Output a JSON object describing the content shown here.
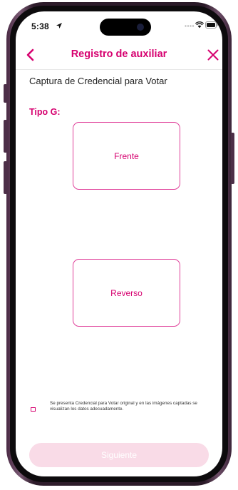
{
  "status_bar": {
    "time": "5:38",
    "icons": [
      "location-arrow-icon",
      "signal-icon",
      "wifi-icon",
      "battery-icon"
    ]
  },
  "header": {
    "title": "Registro de auxiliar",
    "back_icon": "chevron-left-icon",
    "close_icon": "close-icon"
  },
  "main": {
    "section_title": "Captura de Credencial para Votar",
    "type_label": "Tipo G:",
    "front_label": "Frente",
    "back_label": "Reverso"
  },
  "consent": {
    "checked": false,
    "text": "Se presenta Credencial para Votar original y en las imágenes captadas se visualizan los datos adecuadamente."
  },
  "footer": {
    "next_label": "Siguiente",
    "enabled": false
  },
  "colors": {
    "accent": "#d6006f",
    "border_pink": "#e0409a",
    "button_disabled": "#f9dbe7",
    "frame": "#3a2236"
  }
}
